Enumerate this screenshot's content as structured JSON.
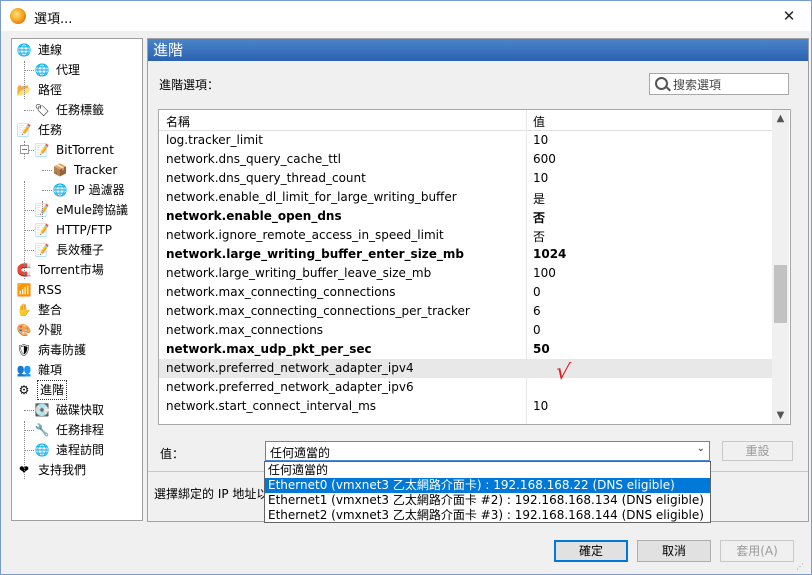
{
  "window": {
    "title": "選項..."
  },
  "tree": {
    "items": [
      {
        "label": "連線",
        "icon": "globe-icon",
        "glyph": "🌐",
        "level": 0
      },
      {
        "label": "代理",
        "icon": "globe-icon",
        "glyph": "🌐",
        "level": 1
      },
      {
        "label": "路徑",
        "icon": "folder-icon",
        "glyph": "📂",
        "level": 0
      },
      {
        "label": "任務標籤",
        "icon": "tag-icon",
        "glyph": "🏷",
        "level": 1
      },
      {
        "label": "任務",
        "icon": "task-icon",
        "glyph": "📝",
        "level": 0
      },
      {
        "label": "BitTorrent",
        "icon": "task-icon",
        "glyph": "📝",
        "level": 1
      },
      {
        "label": "Tracker",
        "icon": "tracker-icon",
        "glyph": "📦",
        "level": 2
      },
      {
        "label": "IP 過濾器",
        "icon": "globe-icon",
        "glyph": "🌐",
        "level": 2
      },
      {
        "label": "eMule跨協議",
        "icon": "task-icon",
        "glyph": "📝",
        "level": 1
      },
      {
        "label": "HTTP/FTP",
        "icon": "task-icon",
        "glyph": "📝",
        "level": 1
      },
      {
        "label": "長效種子",
        "icon": "task-icon",
        "glyph": "📝",
        "level": 1
      },
      {
        "label": "Torrent市場",
        "icon": "magnet-icon",
        "glyph": "🧲",
        "level": 0
      },
      {
        "label": "RSS",
        "icon": "rss-icon",
        "glyph": "📶",
        "level": 0
      },
      {
        "label": "整合",
        "icon": "integration-icon",
        "glyph": "✋",
        "level": 0
      },
      {
        "label": "外觀",
        "icon": "appearance-icon",
        "glyph": "🎨",
        "level": 0
      },
      {
        "label": "病毒防護",
        "icon": "shield-icon",
        "glyph": "🛡",
        "level": 0
      },
      {
        "label": "雜項",
        "icon": "misc-icon",
        "glyph": "👥",
        "level": 0
      },
      {
        "label": "進階",
        "icon": "advanced-icon",
        "glyph": "⚙",
        "level": 0,
        "selected": true
      },
      {
        "label": "磁碟快取",
        "icon": "disk-cache-icon",
        "glyph": "💽",
        "level": 1
      },
      {
        "label": "任務排程",
        "icon": "schedule-icon",
        "glyph": "🔧",
        "level": 1
      },
      {
        "label": "遠程訪問",
        "icon": "remote-access-icon",
        "glyph": "🌐",
        "level": 1
      },
      {
        "label": "支持我們",
        "icon": "heart-icon",
        "glyph": "❤",
        "level": 0
      }
    ]
  },
  "panel": {
    "header": "進階",
    "section_label": "進階選項：",
    "search_placeholder": "搜索選項"
  },
  "grid": {
    "columns": {
      "name": "名稱",
      "value": "值"
    },
    "rows": [
      {
        "name": "log.tracker_limit",
        "value": "10"
      },
      {
        "name": "network.dns_query_cache_ttl",
        "value": "600"
      },
      {
        "name": "network.dns_query_thread_count",
        "value": "10"
      },
      {
        "name": "network.enable_dl_limit_for_large_writing_buffer",
        "value": "是"
      },
      {
        "name": "network.enable_open_dns",
        "value": "否",
        "bold": true
      },
      {
        "name": "network.ignore_remote_access_in_speed_limit",
        "value": "否"
      },
      {
        "name": "network.large_writing_buffer_enter_size_mb",
        "value": "1024",
        "bold": true
      },
      {
        "name": "network.large_writing_buffer_leave_size_mb",
        "value": "100"
      },
      {
        "name": "network.max_connecting_connections",
        "value": "0"
      },
      {
        "name": "network.max_connecting_connections_per_tracker",
        "value": "6"
      },
      {
        "name": "network.max_connections",
        "value": "0"
      },
      {
        "name": "network.max_udp_pkt_per_sec",
        "value": "50",
        "bold": true
      },
      {
        "name": "network.preferred_network_adapter_ipv4",
        "value": "",
        "selected": true
      },
      {
        "name": "network.preferred_network_adapter_ipv6",
        "value": ""
      },
      {
        "name": "network.start_connect_interval_ms",
        "value": "10"
      }
    ],
    "scroll_fraction": 0.62
  },
  "annotation": {
    "checkmark": "√"
  },
  "value_editor": {
    "label": "值：",
    "selected": "任何適當的",
    "reset_label": "重設",
    "options": [
      "任何適當的",
      "Ethernet0 (vmxnet3 乙太網路介面卡) : 192.168.168.22 (DNS eligible)",
      "Ethernet1 (vmxnet3 乙太網路介面卡 #2) : 192.168.168.134 (DNS eligible)",
      "Ethernet2 (vmxnet3 乙太網路介面卡 #3) : 192.168.168.144 (DNS eligible)"
    ],
    "highlighted_index": 1
  },
  "description": "選擇綁定的 IP 地址以",
  "footer": {
    "ok": "確定",
    "cancel": "取消",
    "apply": "套用(A)"
  }
}
